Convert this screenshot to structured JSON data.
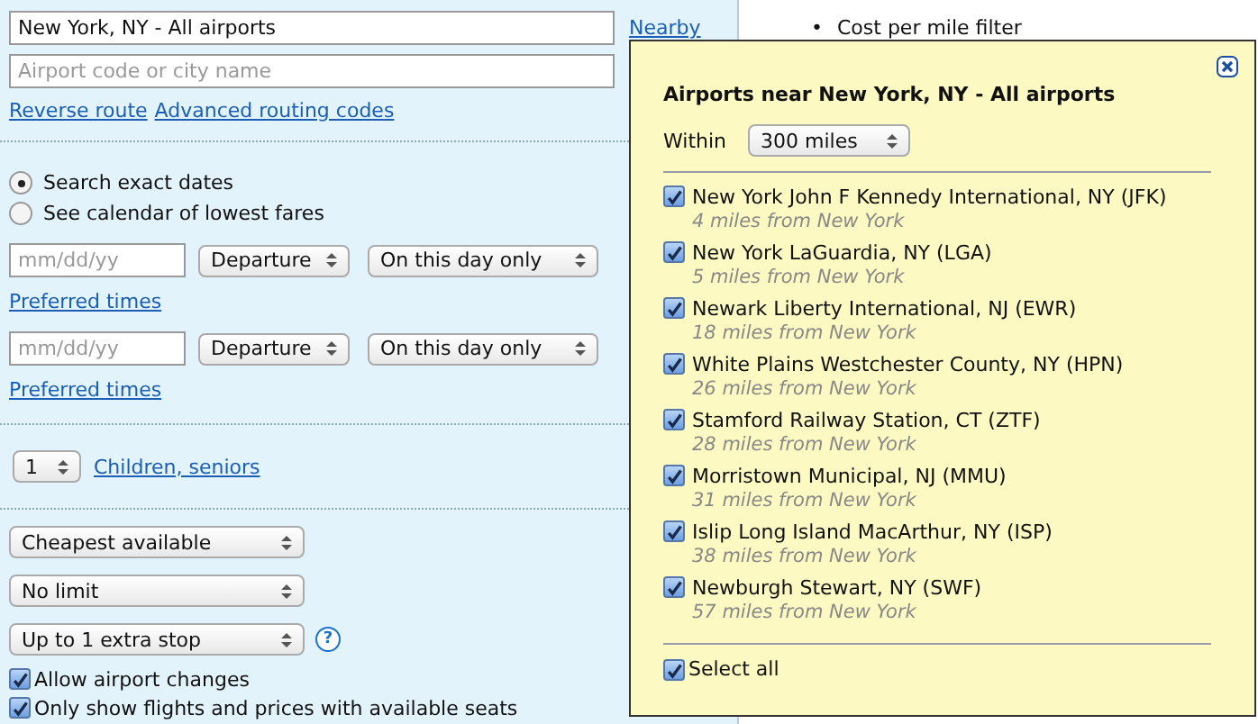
{
  "origin": {
    "value": "New York, NY - All airports",
    "link": "Nearby"
  },
  "destination": {
    "placeholder": "Airport code or city name"
  },
  "route_links": [
    "Reverse route",
    "Advanced routing codes"
  ],
  "date_modes": [
    {
      "label": "Search exact dates",
      "selected": true
    },
    {
      "label": "See calendar of lowest fares",
      "selected": false
    }
  ],
  "legs": [
    {
      "date_placeholder": "mm/dd/yy",
      "time_type": "Departure",
      "flexibility": "On this day only",
      "link": "Preferred times"
    },
    {
      "date_placeholder": "mm/dd/yy",
      "time_type": "Departure",
      "flexibility": "On this day only",
      "link": "Preferred times"
    }
  ],
  "passengers": {
    "count": "1",
    "link": "Children, seniors"
  },
  "fare_selects": [
    {
      "value": "Cheapest available"
    },
    {
      "value": "No limit"
    },
    {
      "value": "Up to 1 extra stop",
      "help": "?"
    }
  ],
  "options": [
    {
      "label": "Allow airport changes",
      "checked": true
    },
    {
      "label": "Only show flights and prices with available seats",
      "checked": true
    }
  ],
  "background": {
    "bullets": [
      {
        "marker": "•",
        "text": "Cost per mile filter"
      }
    ]
  },
  "popup": {
    "title": "Airports near New York, NY - All airports",
    "within_label": "Within",
    "within_value": "300 miles",
    "airports": [
      {
        "name": "New York John F Kennedy International, NY (JFK)",
        "distance": "4 miles from New York",
        "checked": true
      },
      {
        "name": "New York LaGuardia, NY (LGA)",
        "distance": "5 miles from New York",
        "checked": true
      },
      {
        "name": "Newark Liberty International, NJ (EWR)",
        "distance": "18 miles from New York",
        "checked": true
      },
      {
        "name": "White Plains Westchester County, NY (HPN)",
        "distance": "26 miles from New York",
        "checked": true
      },
      {
        "name": "Stamford Railway Station, CT (ZTF)",
        "distance": "28 miles from New York",
        "checked": true
      },
      {
        "name": "Morristown Municipal, NJ (MMU)",
        "distance": "31 miles from New York",
        "checked": true
      },
      {
        "name": "Islip Long Island MacArthur, NY (ISP)",
        "distance": "38 miles from New York",
        "checked": true
      },
      {
        "name": "Newburgh Stewart, NY (SWF)",
        "distance": "57 miles from New York",
        "checked": true
      }
    ],
    "select_all": {
      "label": "Select all",
      "checked": true
    }
  }
}
